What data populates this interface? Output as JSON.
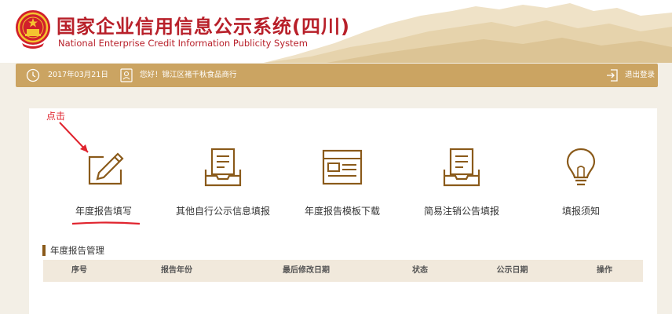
{
  "header": {
    "title_cn": "国家企业信用信息公示系统(四川)",
    "title_en": "National Enterprise Credit Information Publicity System"
  },
  "status_bar": {
    "date": "2017年03月21日",
    "greeting": "您好！锦江区褚千秋食品商行",
    "logout": "退出登录"
  },
  "annotation": {
    "text": "点击"
  },
  "tiles": [
    {
      "label": "年度报告填写",
      "icon": "pencil-edit-icon"
    },
    {
      "label": "其他自行公示信息填报",
      "icon": "document-tray-icon"
    },
    {
      "label": "年度报告模板下载",
      "icon": "template-icon"
    },
    {
      "label": "简易注销公告填报",
      "icon": "document-tray-icon"
    },
    {
      "label": "填报须知",
      "icon": "lightbulb-icon"
    }
  ],
  "section": {
    "title": "年度报告管理"
  },
  "table": {
    "columns": [
      "序号",
      "报告年份",
      "最后修改日期",
      "状态",
      "公示日期",
      "操作"
    ]
  },
  "colors": {
    "brand_red": "#b8202a",
    "gold": "#cba462",
    "icon_brown": "#8a5a1a",
    "annotation_red": "#e0242e"
  }
}
